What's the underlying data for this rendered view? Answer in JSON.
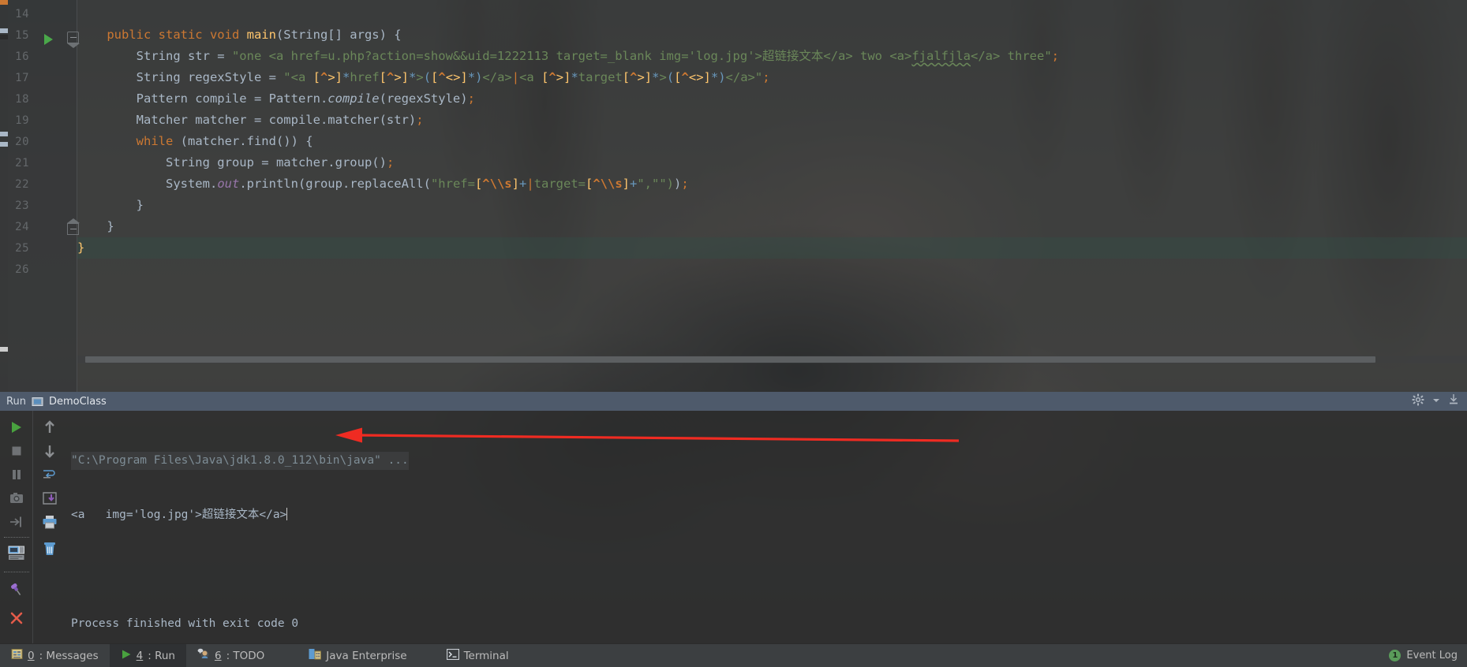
{
  "editor": {
    "first_line": 14,
    "line_numbers": [
      14,
      15,
      16,
      17,
      18,
      19,
      20,
      21,
      22,
      23,
      24,
      25,
      26
    ],
    "run_marker_line": 15,
    "code_lines": [
      {
        "n": 14,
        "text": ""
      },
      {
        "n": 15,
        "text": "    public static void main(String[] args) {"
      },
      {
        "n": 16,
        "text": "        String str = \"one <a href=u.php?action=show&&uid=1222113 target=_blank img='log.jpg'>超链接文本</a> two <a>fjalfjla</a> three\";"
      },
      {
        "n": 17,
        "text": "        String regexStyle = \"<a [^>]*href[^>]*>([^<>]*)</a>|<a [^>]*target[^>]*>([^<>]*)</a>\";"
      },
      {
        "n": 18,
        "text": "        Pattern compile = Pattern.compile(regexStyle);"
      },
      {
        "n": 19,
        "text": "        Matcher matcher = compile.matcher(str);"
      },
      {
        "n": 20,
        "text": "        while (matcher.find()) {"
      },
      {
        "n": 21,
        "text": "            String group = matcher.group();"
      },
      {
        "n": 22,
        "text": "            System.out.println(group.replaceAll(\"href=[^\\\\s]+|target=[^\\\\s]+\",\"\"));"
      },
      {
        "n": 23,
        "text": "        }"
      },
      {
        "n": 24,
        "text": "    }"
      },
      {
        "n": 25,
        "text": "}"
      },
      {
        "n": 26,
        "text": ""
      }
    ],
    "highlighted_line": 25,
    "typo_word": "fjalfjla"
  },
  "run_window": {
    "title": "Run",
    "tab_name": "DemoClass",
    "config_icon": "gear-icon",
    "collapse_icon": "hide-icon",
    "left_toolbar": [
      {
        "name": "rerun-button",
        "icon": "play-icon"
      },
      {
        "name": "stop-button",
        "icon": "stop-square-icon"
      },
      {
        "name": "pause-button",
        "icon": "pause-icon"
      },
      {
        "name": "dump-threads-button",
        "icon": "camera-icon"
      },
      {
        "name": "restore-layout-button",
        "icon": "enter-arrow-icon"
      },
      {
        "name": "console-view-button",
        "icon": "console-window-icon"
      },
      {
        "name": "pin-tab-button",
        "icon": "pushpin-icon"
      },
      {
        "name": "close-button",
        "icon": "close-x-icon"
      }
    ],
    "right_toolbar": [
      {
        "name": "up-stack-button",
        "icon": "arrow-up-icon"
      },
      {
        "name": "down-stack-button",
        "icon": "arrow-down-icon"
      },
      {
        "name": "soft-wrap-button",
        "icon": "soft-wrap-icon"
      },
      {
        "name": "scroll-to-end-button",
        "icon": "scroll-end-icon"
      },
      {
        "name": "print-button",
        "icon": "printer-icon"
      },
      {
        "name": "clear-all-button",
        "icon": "trash-icon"
      }
    ],
    "console_lines": [
      {
        "type": "command",
        "text": "\"C:\\Program Files\\Java\\jdk1.8.0_112\\bin\\java\" ..."
      },
      {
        "type": "output",
        "text": "<a   img='log.jpg'>超链接文本</a>"
      },
      {
        "type": "blank",
        "text": ""
      },
      {
        "type": "output",
        "text": "Process finished with exit code 0"
      }
    ],
    "annotation": {
      "name": "red-arrow",
      "color": "#ef2b22",
      "points_to": "console output line 2"
    }
  },
  "status_bar": {
    "tabs": [
      {
        "name": "messages",
        "mnemonic": "0",
        "label": ": Messages",
        "icon": "messages-icon",
        "active": false
      },
      {
        "name": "run",
        "mnemonic": "4",
        "label": ": Run",
        "icon": "play-icon",
        "active": true
      },
      {
        "name": "todo",
        "mnemonic": "6",
        "label": ": TODO",
        "icon": "todo-icon",
        "active": false
      },
      {
        "name": "java-enterprise",
        "mnemonic": "",
        "label": "Java Enterprise",
        "icon": "java-ee-icon",
        "active": false
      },
      {
        "name": "terminal",
        "mnemonic": "",
        "label": "Terminal",
        "icon": "terminal-icon",
        "active": false
      }
    ],
    "event_log": {
      "label": "Event Log",
      "count": "1"
    }
  },
  "colors": {
    "accent_run_header": "#4e5a6b",
    "keyword": "#cc7832",
    "string": "#6a8759",
    "number": "#6897bb",
    "field": "#9876aa",
    "arrow_red": "#ef2b22",
    "green_run": "#4aa84a"
  }
}
